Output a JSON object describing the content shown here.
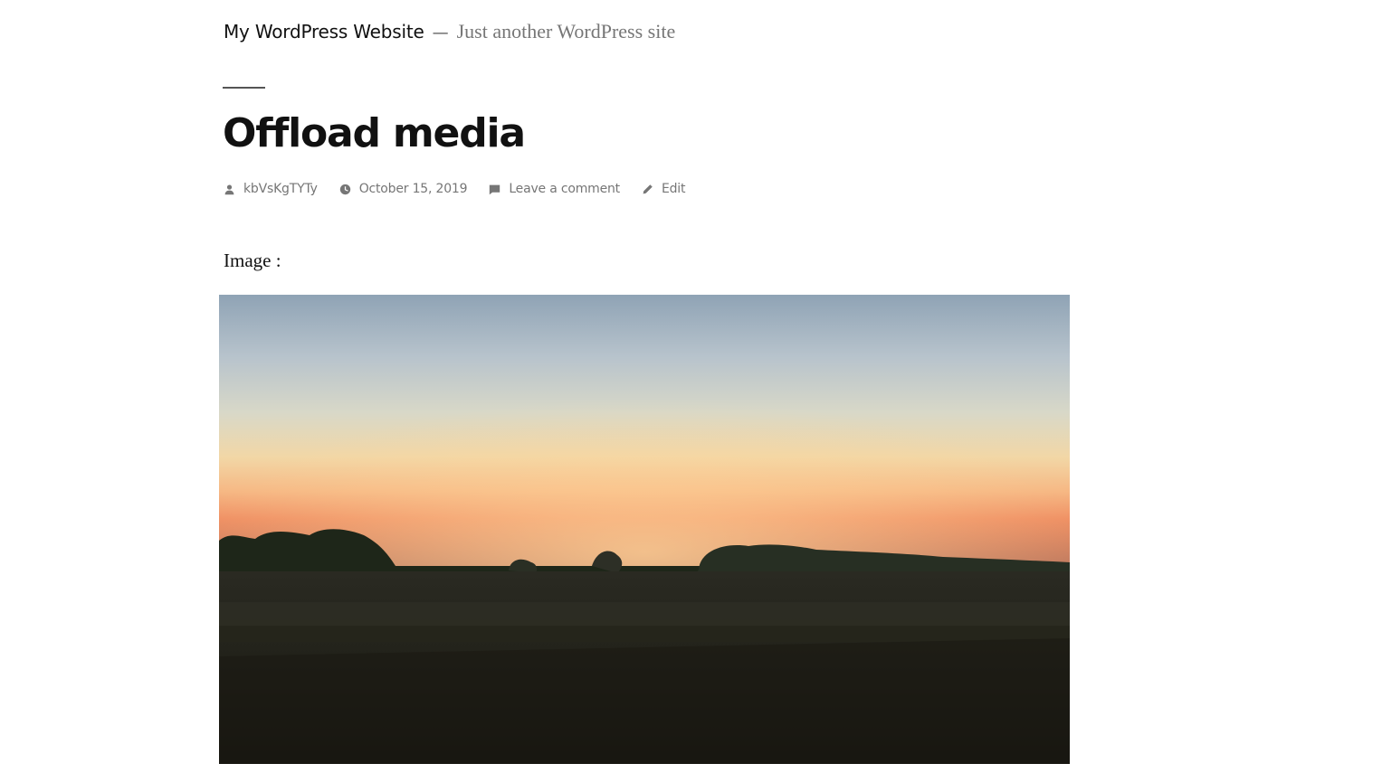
{
  "site": {
    "title": "My WordPress Website",
    "separator": "—",
    "description": "Just another WordPress site"
  },
  "post": {
    "title": "Offload media",
    "meta": {
      "author": "kbVsKgTYTy",
      "author_icon": "person-icon",
      "date": "October 15, 2019",
      "date_icon": "clock-icon",
      "comment": "Leave a comment",
      "comment_icon": "comment-icon",
      "edit": "Edit",
      "edit_icon": "pencil-icon"
    },
    "content": {
      "text": "Image :",
      "image": {
        "subject": "sunset over a field"
      }
    }
  },
  "colors": {
    "text": "#111111",
    "meta": "#767676",
    "sky_top": "#8fa3b5",
    "sunset_glow": "#f5a066",
    "field": "#1e1e17"
  }
}
